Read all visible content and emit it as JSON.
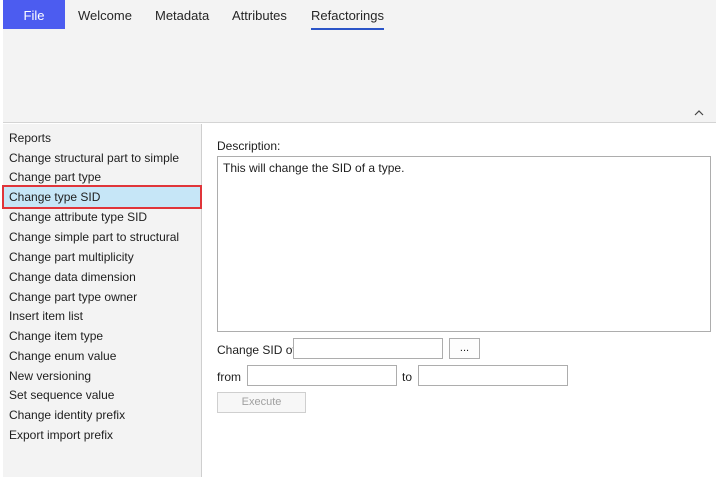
{
  "ribbon": {
    "tabs": [
      {
        "label": "File"
      },
      {
        "label": "Welcome"
      },
      {
        "label": "Metadata"
      },
      {
        "label": "Attributes"
      },
      {
        "label": "Refactorings"
      }
    ],
    "active_tab": "Refactorings",
    "collapse_icon": "chevron-up-icon"
  },
  "sidebar": {
    "items": [
      {
        "label": "Reports"
      },
      {
        "label": "Change structural part to simple"
      },
      {
        "label": "Change part type"
      },
      {
        "label": "Change type SID"
      },
      {
        "label": "Change attribute type SID"
      },
      {
        "label": "Change simple part to structural"
      },
      {
        "label": "Change part multiplicity"
      },
      {
        "label": "Change data dimension"
      },
      {
        "label": "Change part type owner"
      },
      {
        "label": "Insert item list"
      },
      {
        "label": "Change item type"
      },
      {
        "label": "Change enum value"
      },
      {
        "label": "New versioning"
      },
      {
        "label": "Set sequence value"
      },
      {
        "label": "Change identity prefix"
      },
      {
        "label": "Export import prefix"
      }
    ],
    "selected": "Change type SID",
    "selected_highlight_color": "#c6e6f7",
    "selected_outline_color": "#e0353a"
  },
  "main": {
    "description_label": "Description:",
    "description_text": "This will change the SID of a type.",
    "change_sid_label": "Change SID of",
    "change_sid_value": "",
    "browse_button_label": "...",
    "from_label": "from",
    "from_value": "",
    "to_label": "to",
    "to_value": "",
    "execute_button_label": "Execute"
  },
  "colors": {
    "file_tab": "#4c5cf0",
    "active_underline": "#2b55c8"
  }
}
